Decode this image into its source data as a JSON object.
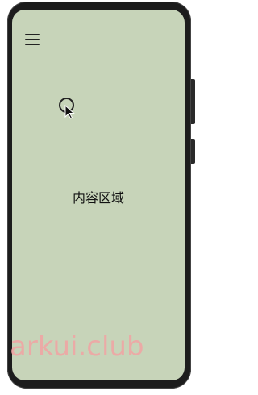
{
  "screen": {
    "background_color": "#c7d4b9",
    "content_text": "内容区域"
  },
  "toolbar": {
    "menu_icon": "hamburger-menu-icon"
  },
  "watermark": {
    "text": "arkui.club",
    "color": "#f2a3a3"
  },
  "pointer": {
    "icon": "mouse-cursor-icon"
  }
}
